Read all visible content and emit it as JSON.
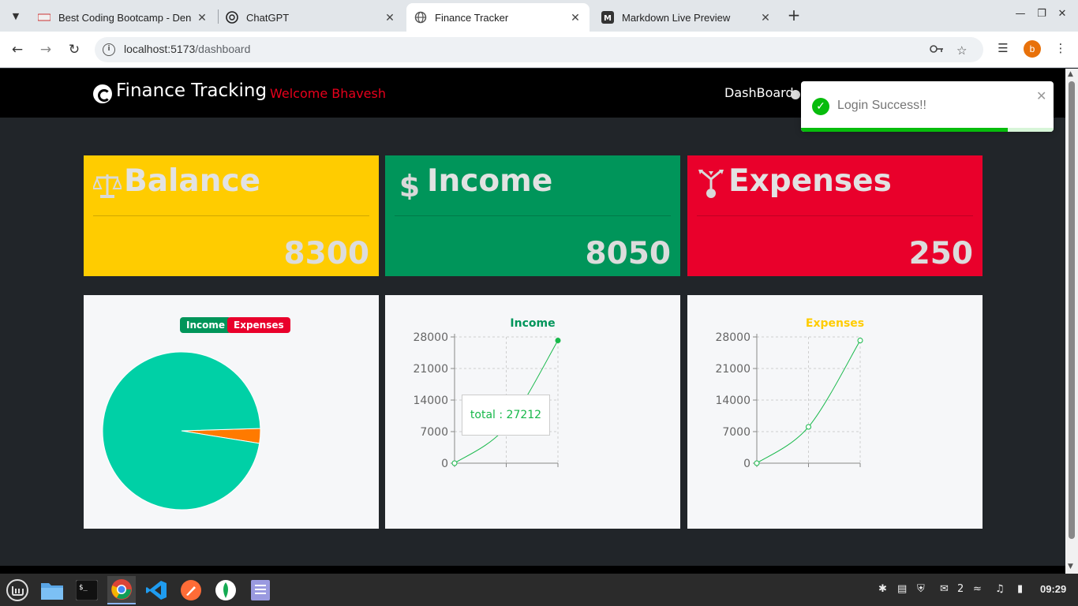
{
  "browser": {
    "tabs": [
      {
        "title": "Best Coding Bootcamp - Den",
        "favicon": "bootcamp-favicon"
      },
      {
        "title": "ChatGPT",
        "favicon": "chatgpt-favicon"
      },
      {
        "title": "Finance Tracker",
        "favicon": "globe-favicon"
      },
      {
        "title": "Markdown Live Preview",
        "favicon": "markdown-favicon"
      }
    ],
    "url_host": "localhost:5173",
    "url_path": "/dashboard",
    "profile_initial": "b"
  },
  "app": {
    "brand": "Finance Tracking",
    "welcome": "Welcome Bhavesh",
    "nav_dashboard": "DashBoard"
  },
  "cards": {
    "balance": {
      "title": "Balance",
      "value": "8300",
      "icon": "balance-scale-icon",
      "color": "#ffcc00"
    },
    "income": {
      "title": "Income",
      "value": "8050",
      "icon": "dollar-icon",
      "color": "#00955a"
    },
    "expenses": {
      "title": "Expenses",
      "value": "250",
      "icon": "expenses-icon",
      "color": "#e9002b"
    }
  },
  "toast": {
    "message": "Login Success!!",
    "progress": 0.82
  },
  "chart_data": [
    {
      "type": "pie",
      "legend": [
        "Income",
        "Expenses"
      ],
      "labels": [
        "Income",
        "Expenses"
      ],
      "values": [
        8050,
        250
      ],
      "colors": [
        "#00d0a6",
        "#ff7a00"
      ],
      "legend_colors": [
        "#00955a",
        "#e9002b"
      ]
    },
    {
      "type": "line",
      "title": "Income",
      "title_color": "#00955a",
      "series": [
        {
          "name": "total",
          "x": [
            0,
            1,
            2
          ],
          "values": [
            0,
            8050,
            27212
          ]
        }
      ],
      "yticks": [
        0,
        7000,
        14000,
        21000,
        28000
      ],
      "ylim": [
        0,
        28000
      ],
      "tooltip": "total : 27212",
      "line_color": "#17b84a"
    },
    {
      "type": "line",
      "title": "Expenses",
      "title_color": "#ffcc00",
      "series": [
        {
          "name": "total",
          "x": [
            0,
            1,
            2
          ],
          "values": [
            0,
            8050,
            27212
          ]
        }
      ],
      "yticks": [
        0,
        7000,
        14000,
        21000,
        28000
      ],
      "ylim": [
        0,
        28000
      ],
      "line_color": "#17b84a"
    }
  ],
  "taskbar": {
    "apps": [
      "mint-menu-icon",
      "files-icon",
      "terminal-icon",
      "chrome-icon",
      "vscode-icon",
      "postman-icon",
      "mongodb-icon",
      "text-editor-icon"
    ],
    "notification_count": "2",
    "clock": "09:29"
  }
}
